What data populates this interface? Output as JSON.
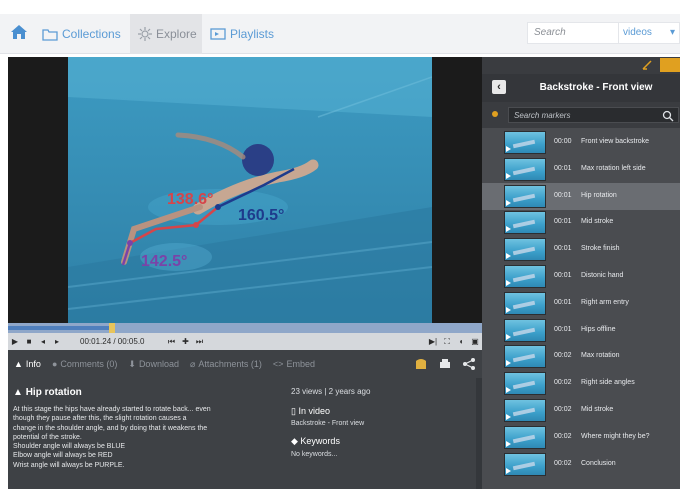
{
  "nav": {
    "collections": "Collections",
    "explore": "Explore",
    "playlists": "Playlists",
    "search_placeholder": "Search",
    "search_scope": "videos"
  },
  "player": {
    "angles": {
      "red": "138.6°",
      "blue": "160.5°",
      "purple": "142.5°"
    },
    "timecode": "00:01.24 / 00:05.0",
    "progress_fraction": 0.22,
    "annotation_colors": {
      "shoulder": "#1e3b8c",
      "elbow": "#d5454a",
      "wrist": "#7a43a8"
    }
  },
  "tabs": {
    "info": "Info",
    "comments": "Comments (0)",
    "download": "Download",
    "attachments": "Attachments (1)",
    "embed": "Embed"
  },
  "info": {
    "title": "Hip rotation",
    "description_lines": [
      "At this stage the hips have already started to rotate back... even",
      "though they pause after this, the slight rotation causes a",
      "change in the shoulder angle, and by doing that it weakens the",
      "potential of the stroke.",
      "Shoulder angle will always be BLUE",
      "Elbow angle will always be RED",
      "Wrist angle will always be PURPLE."
    ],
    "stats": "23 views | 2 years ago",
    "in_video_label": "In video",
    "in_video_value": "Backstroke - Front view",
    "keywords_label": "Keywords",
    "keywords_value": "No keywords..."
  },
  "markers_panel": {
    "title": "Backstroke - Front view",
    "search_placeholder": "Search markers",
    "markers": [
      {
        "time": "00:00",
        "label": "Front view backstroke"
      },
      {
        "time": "00:01",
        "label": "Max rotation left side"
      },
      {
        "time": "00:01",
        "label": "Hip rotation"
      },
      {
        "time": "00:01",
        "label": "Mid stroke"
      },
      {
        "time": "00:01",
        "label": "Stroke finish"
      },
      {
        "time": "00:01",
        "label": "Distonic hand"
      },
      {
        "time": "00:01",
        "label": "Right arm entry"
      },
      {
        "time": "00:01",
        "label": "Hips offline"
      },
      {
        "time": "00:02",
        "label": "Max rotation"
      },
      {
        "time": "00:02",
        "label": "Right side angles"
      },
      {
        "time": "00:02",
        "label": "Mid stroke"
      },
      {
        "time": "00:02",
        "label": "Where might they be?"
      },
      {
        "time": "00:02",
        "label": "Conclusion"
      }
    ],
    "active_index": 2
  }
}
